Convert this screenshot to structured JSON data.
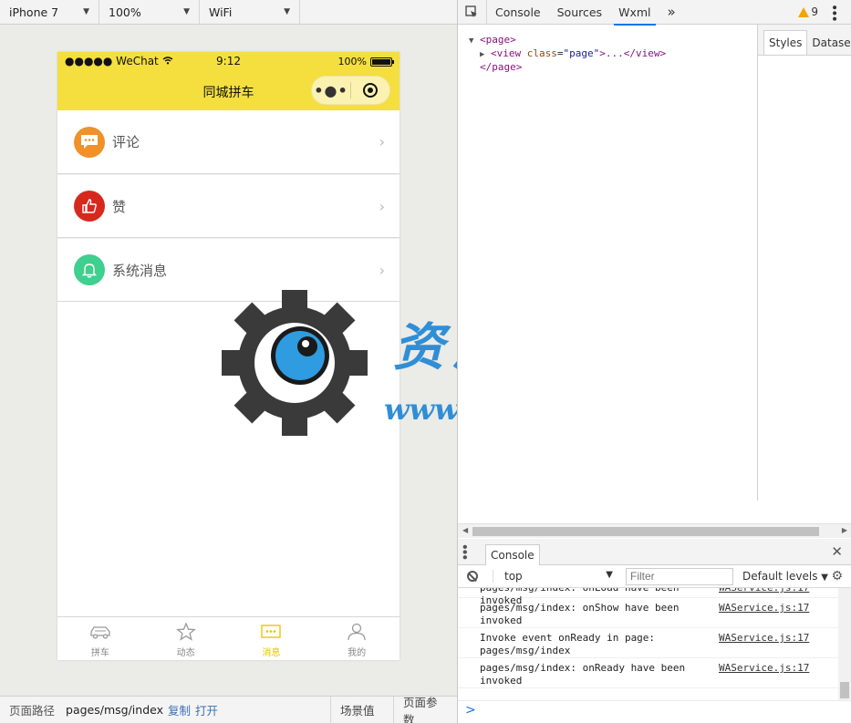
{
  "device_bar": {
    "device": "iPhone 7",
    "zoom": "100%",
    "network": "WiFi"
  },
  "phone": {
    "status_bar": {
      "carrier": "●●●●● WeChat",
      "time": "9:12",
      "battery": "100%"
    },
    "nav_title": "同城拼车",
    "capsule_menu": "•●•",
    "messages": [
      {
        "label": "评论",
        "icon": "comment-icon",
        "color": "#f0912a"
      },
      {
        "label": "赞",
        "icon": "thumbs-up-icon",
        "color": "#d6291d"
      },
      {
        "label": "系统消息",
        "icon": "bell-icon",
        "color": "#3fcf8e"
      }
    ],
    "tabs": [
      {
        "label": "拼车",
        "icon": "car-icon",
        "active": false
      },
      {
        "label": "动态",
        "icon": "star-icon",
        "active": false
      },
      {
        "label": "消息",
        "icon": "message-icon",
        "active": true
      },
      {
        "label": "我的",
        "icon": "user-icon",
        "active": false
      }
    ]
  },
  "watermark": {
    "title": "资源邦",
    "url": "www.wazyb.com"
  },
  "path_bar": {
    "label": "页面路径",
    "path": "pages/msg/index",
    "copy": "复制",
    "open": "打开",
    "scene": "场景值",
    "params": "页面参数"
  },
  "devtools": {
    "tabs": [
      "Console",
      "Sources",
      "Wxml"
    ],
    "active_tab": "Wxml",
    "more": "»",
    "warnings": "9",
    "wxml": {
      "page_open": "<page>",
      "view_tag_open": "<view",
      "attr_name": "class",
      "attr_value": "\"page\"",
      "view_rest": ">...</view>",
      "page_close": "</page>"
    },
    "side_tabs": [
      "Styles",
      "Dataset"
    ],
    "drawer_tab": "Console",
    "context": "top",
    "filter_placeholder": "Filter",
    "levels": "Default levels",
    "logs": [
      {
        "msg": "pages/msg/index: onLoad have been invoked",
        "src": "WAService.js:17"
      },
      {
        "msg": "pages/msg/index: onShow have been invoked",
        "src": "WAService.js:17"
      },
      {
        "msg": "Invoke event onReady in page: pages/msg/index",
        "src": "WAService.js:17"
      },
      {
        "msg": "pages/msg/index: onReady have been invoked",
        "src": "WAService.js:17"
      }
    ],
    "prompt": ">"
  }
}
